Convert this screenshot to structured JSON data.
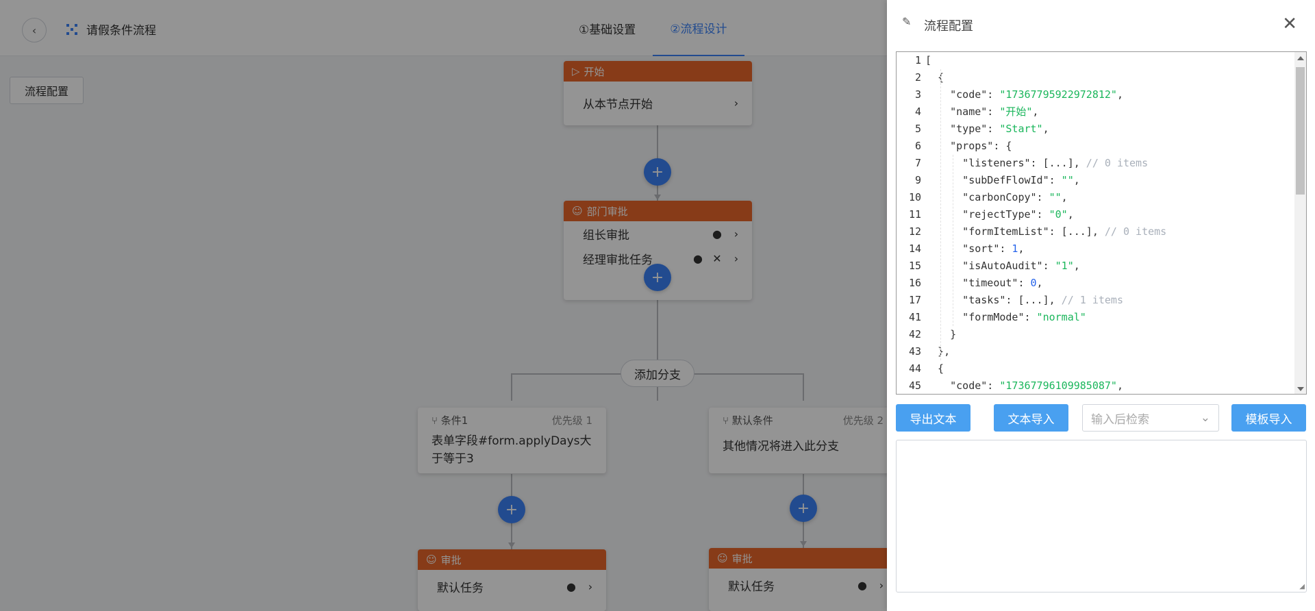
{
  "header": {
    "back_icon": "chevron-left-icon",
    "flow_icon": "flow-icon",
    "title": "请假条件流程",
    "steps": [
      {
        "label": "①基础设置",
        "active": false
      },
      {
        "label": "②流程设计",
        "active": true
      }
    ]
  },
  "toolbar": {
    "config_button": "流程配置"
  },
  "flow": {
    "start": {
      "head": "开始",
      "row": "从本节点开始"
    },
    "dept": {
      "head": "部门审批",
      "rows": [
        "组长审批",
        "经理审批任务"
      ]
    },
    "add_branch": "添加分支",
    "branches": [
      {
        "name": "条件1",
        "priority": "优先级 1",
        "body": "表单字段#form.applyDays大于等于3",
        "approval_head": "审批",
        "approval_row": "默认任务"
      },
      {
        "name": "默认条件",
        "priority": "优先级 2",
        "body": "其他情况将进入此分支",
        "approval_head": "审批",
        "approval_row": "默认任务"
      }
    ],
    "colors": {
      "node_head": "#e8672a",
      "accent": "#3b82f6"
    }
  },
  "drawer": {
    "title": "流程配置",
    "edit_icon": "edit-icon",
    "close_icon": "close-icon",
    "code_lines": [
      {
        "n": "1",
        "indent": 0,
        "parts": [
          [
            "k",
            "["
          ]
        ]
      },
      {
        "n": "2",
        "indent": 1,
        "parts": [
          [
            "k",
            "{"
          ]
        ]
      },
      {
        "n": "3",
        "indent": 2,
        "parts": [
          [
            "k",
            "\"code\": "
          ],
          [
            "s",
            "\"17367795922972812\""
          ],
          [
            "k",
            ","
          ]
        ]
      },
      {
        "n": "4",
        "indent": 2,
        "parts": [
          [
            "k",
            "\"name\": "
          ],
          [
            "s",
            "\"开始\""
          ],
          [
            "k",
            ","
          ]
        ]
      },
      {
        "n": "5",
        "indent": 2,
        "parts": [
          [
            "k",
            "\"type\": "
          ],
          [
            "s",
            "\"Start\""
          ],
          [
            "k",
            ","
          ]
        ]
      },
      {
        "n": "6",
        "indent": 2,
        "parts": [
          [
            "k",
            "\"props\": {"
          ]
        ]
      },
      {
        "n": "7",
        "indent": 3,
        "parts": [
          [
            "k",
            "\"listeners\": [...], "
          ],
          [
            "c",
            "// 0 items"
          ]
        ]
      },
      {
        "n": "9",
        "indent": 3,
        "parts": [
          [
            "k",
            "\"subDefFlowId\": "
          ],
          [
            "s",
            "\"\""
          ],
          [
            "k",
            ","
          ]
        ]
      },
      {
        "n": "10",
        "indent": 3,
        "parts": [
          [
            "k",
            "\"carbonCopy\": "
          ],
          [
            "s",
            "\"\""
          ],
          [
            "k",
            ","
          ]
        ]
      },
      {
        "n": "11",
        "indent": 3,
        "parts": [
          [
            "k",
            "\"rejectType\": "
          ],
          [
            "s",
            "\"0\""
          ],
          [
            "k",
            ","
          ]
        ]
      },
      {
        "n": "12",
        "indent": 3,
        "parts": [
          [
            "k",
            "\"formItemList\": [...], "
          ],
          [
            "c",
            "// 0 items"
          ]
        ]
      },
      {
        "n": "14",
        "indent": 3,
        "parts": [
          [
            "k",
            "\"sort\": "
          ],
          [
            "n",
            "1"
          ],
          [
            "k",
            ","
          ]
        ]
      },
      {
        "n": "15",
        "indent": 3,
        "parts": [
          [
            "k",
            "\"isAutoAudit\": "
          ],
          [
            "s",
            "\"1\""
          ],
          [
            "k",
            ","
          ]
        ]
      },
      {
        "n": "16",
        "indent": 3,
        "parts": [
          [
            "k",
            "\"timeout\": "
          ],
          [
            "n",
            "0"
          ],
          [
            "k",
            ","
          ]
        ]
      },
      {
        "n": "17",
        "indent": 3,
        "parts": [
          [
            "k",
            "\"tasks\": [...], "
          ],
          [
            "c",
            "// 1 items"
          ]
        ]
      },
      {
        "n": "41",
        "indent": 3,
        "parts": [
          [
            "k",
            "\"formMode\": "
          ],
          [
            "s",
            "\"normal\""
          ]
        ]
      },
      {
        "n": "42",
        "indent": 2,
        "parts": [
          [
            "k",
            "}"
          ]
        ]
      },
      {
        "n": "43",
        "indent": 1,
        "parts": [
          [
            "k",
            "},"
          ]
        ]
      },
      {
        "n": "44",
        "indent": 1,
        "parts": [
          [
            "k",
            "{"
          ]
        ]
      },
      {
        "n": "45",
        "indent": 2,
        "parts": [
          [
            "k",
            "\"code\": "
          ],
          [
            "s",
            "\"17367796109985087\""
          ],
          [
            "k",
            ","
          ]
        ]
      }
    ],
    "export_button": "导出文本",
    "import_button": "文本导入",
    "search_placeholder": "输入后检索",
    "template_button": "模板导入",
    "textarea_value": ""
  }
}
